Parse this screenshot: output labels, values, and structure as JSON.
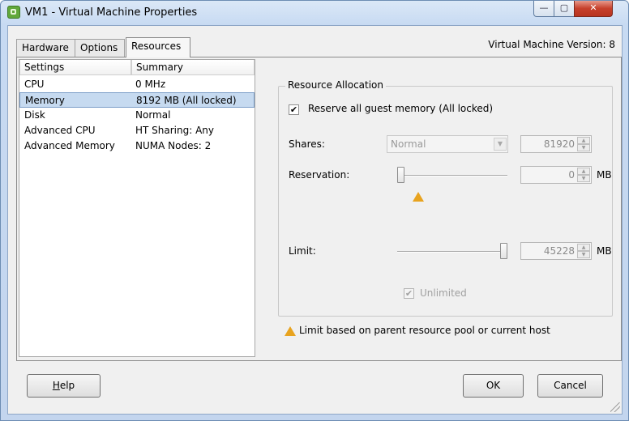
{
  "window": {
    "title": "VM1 - Virtual Machine Properties",
    "controls": {
      "minimize": "—",
      "maximize": "▢",
      "close": "✕"
    }
  },
  "tabs": [
    {
      "label": "Hardware"
    },
    {
      "label": "Options"
    },
    {
      "label": "Resources"
    }
  ],
  "active_tab": "Resources",
  "vm_version": "Virtual Machine Version: 8",
  "settings_list": {
    "headers": {
      "settings": "Settings",
      "summary": "Summary"
    },
    "rows": [
      {
        "setting": "CPU",
        "summary": "0 MHz"
      },
      {
        "setting": "Memory",
        "summary": "8192 MB (All locked)"
      },
      {
        "setting": "Disk",
        "summary": "Normal"
      },
      {
        "setting": "Advanced CPU",
        "summary": "HT Sharing: Any"
      },
      {
        "setting": "Advanced Memory",
        "summary": "NUMA Nodes: 2"
      }
    ],
    "selected": "Memory"
  },
  "resource_allocation": {
    "legend": "Resource Allocation",
    "reserve_all": {
      "label": "Reserve all guest memory (All locked)",
      "checked": true
    },
    "shares": {
      "label": "Shares:",
      "selected": "Normal",
      "value": "81920"
    },
    "reservation": {
      "label": "Reservation:",
      "value": "0",
      "unit": "MB",
      "slider_fraction": 0.0
    },
    "limit": {
      "label": "Limit:",
      "value": "45228",
      "unit": "MB",
      "slider_fraction": 1.0
    },
    "unlimited": {
      "label": "Unlimited",
      "checked": true,
      "enabled": false
    }
  },
  "note": "Limit based on parent resource pool or current host",
  "colors": {
    "warning": "#e8a31f",
    "selection": "#c6daf0"
  },
  "buttons": {
    "help": "Help",
    "ok": "OK",
    "cancel": "Cancel"
  }
}
